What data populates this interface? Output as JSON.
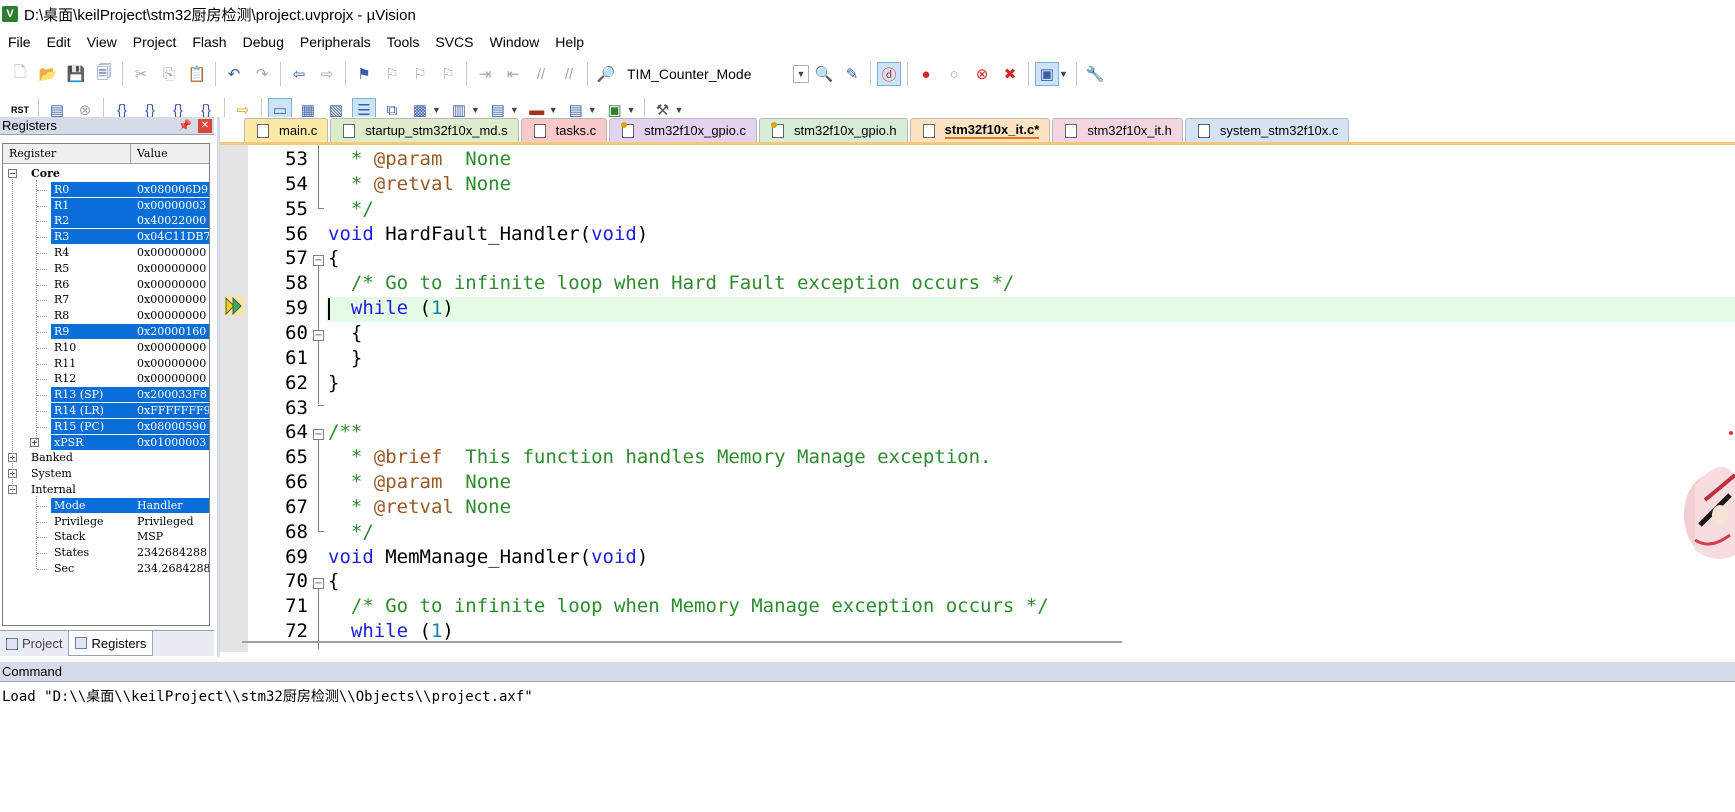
{
  "window": {
    "title": "D:\\桌面\\keilProject\\stm32厨房检测\\project.uvprojx - µVision",
    "icon_label": "V"
  },
  "menu": [
    "File",
    "Edit",
    "View",
    "Project",
    "Flash",
    "Debug",
    "Peripherals",
    "Tools",
    "SVCS",
    "Window",
    "Help"
  ],
  "toolbar": {
    "target_combo": "TIM_Counter_Mode",
    "reset_label": "RST"
  },
  "registers_panel": {
    "title": "Registers",
    "col_register": "Register",
    "col_value": "Value",
    "groups": {
      "core": "Core",
      "banked": "Banked",
      "system": "System",
      "internal": "Internal"
    },
    "core": [
      {
        "name": "R0",
        "value": "0x080006D9"
      },
      {
        "name": "R1",
        "value": "0x00000003"
      },
      {
        "name": "R2",
        "value": "0x40022000"
      },
      {
        "name": "R3",
        "value": "0x04C11DB7"
      },
      {
        "name": "R4",
        "value": "0x00000000"
      },
      {
        "name": "R5",
        "value": "0x00000000"
      },
      {
        "name": "R6",
        "value": "0x00000000"
      },
      {
        "name": "R7",
        "value": "0x00000000"
      },
      {
        "name": "R8",
        "value": "0x00000000"
      },
      {
        "name": "R9",
        "value": "0x20000160"
      },
      {
        "name": "R10",
        "value": "0x00000000"
      },
      {
        "name": "R11",
        "value": "0x00000000"
      },
      {
        "name": "R12",
        "value": "0x00000000"
      },
      {
        "name": "R13 (SP)",
        "value": "0x200033F8"
      },
      {
        "name": "R14 (LR)",
        "value": "0xFFFFFFF9"
      },
      {
        "name": "R15 (PC)",
        "value": "0x08000590"
      },
      {
        "name": "xPSR",
        "value": "0x01000003"
      }
    ],
    "internal": [
      {
        "name": "Mode",
        "value": "Handler"
      },
      {
        "name": "Privilege",
        "value": "Privileged"
      },
      {
        "name": "Stack",
        "value": "MSP"
      },
      {
        "name": "States",
        "value": "2342684288"
      },
      {
        "name": "Sec",
        "value": "234.2684288"
      }
    ],
    "tabs": [
      "Project",
      "Registers"
    ]
  },
  "editor_tabs": [
    "main.c",
    "startup_stm32f10x_md.s",
    "tasks.c",
    "stm32f10x_gpio.c",
    "stm32f10x_gpio.h",
    "stm32f10x_it.c*",
    "stm32f10x_it.h",
    "system_stm32f10x.c"
  ],
  "tab_colors": [
    "#fbe9a6",
    "#ddeccb",
    "#f7c9c9",
    "#e3d3ef",
    "#d6ecd6",
    "#fde3c2",
    "#f3d4e2",
    "#d5e4f3"
  ],
  "code": {
    "line_numbers": [
      "53",
      "54",
      "55",
      "56",
      "57",
      "58",
      "59",
      "60",
      "61",
      "62",
      "63",
      "64",
      "65",
      "66",
      "67",
      "68",
      "69",
      "70",
      "71",
      "72"
    ],
    "l53": {
      "a": "  * ",
      "b": "@param",
      "c": "  None"
    },
    "l54": {
      "a": "  * ",
      "b": "@retval",
      "c": " None"
    },
    "l55": "  */",
    "l56": {
      "kw1": "void",
      "fn": " HardFault_Handler(",
      "kw2": "void",
      "end": ")"
    },
    "l57": "{",
    "l58": "  /* Go to infinite loop when Hard Fault exception occurs */",
    "l59": {
      "kw": "  while",
      "mid": " (",
      "num": "1",
      "end": ")"
    },
    "l60": "  {",
    "l61": "  }",
    "l62": "}",
    "l64": "/**",
    "l65": {
      "a": "  * ",
      "b": "@brief",
      "c": "  This function handles Memory Manage exception."
    },
    "l66": {
      "a": "  * ",
      "b": "@param",
      "c": "  None"
    },
    "l67": {
      "a": "  * ",
      "b": "@retval",
      "c": " None"
    },
    "l68": "  */",
    "l69": {
      "kw1": "void",
      "fn": " MemManage_Handler(",
      "kw2": "void",
      "end": ")"
    },
    "l70": "{",
    "l71": "  /* Go to infinite loop when Memory Manage exception occurs */",
    "l72": {
      "kw": "  while",
      "mid": " (",
      "num": "1",
      "end": ")"
    }
  },
  "command": {
    "title": "Command",
    "line": "Load \"D:\\\\桌面\\\\keilProject\\\\stm32厨房检测\\\\Objects\\\\project.axf\""
  }
}
